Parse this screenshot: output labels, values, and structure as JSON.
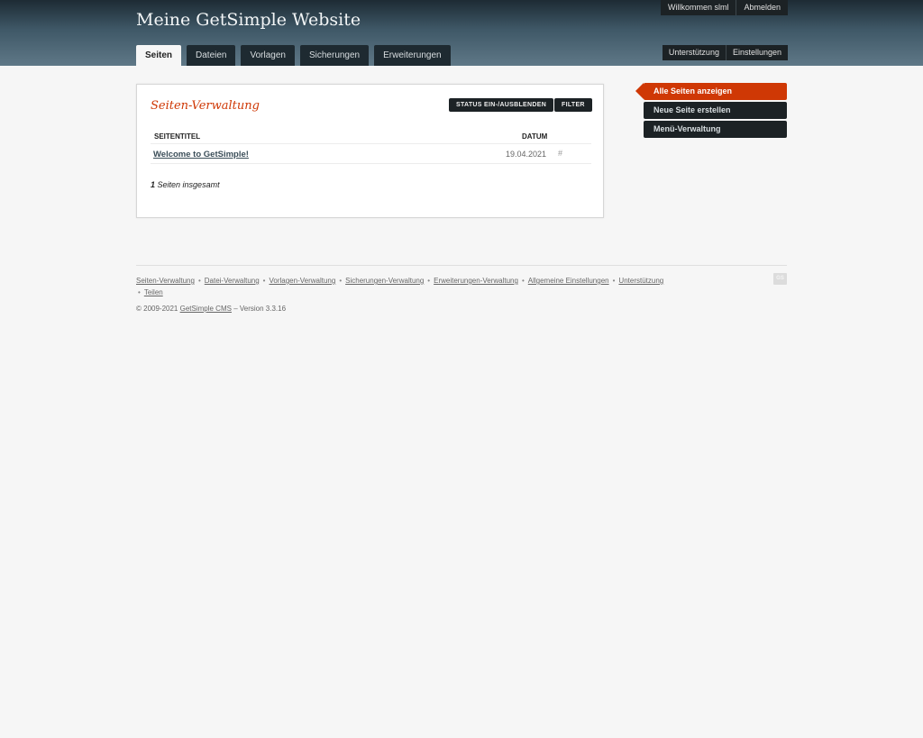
{
  "header": {
    "site_title": "Meine GetSimple Website",
    "welcome": "Willkommen slml",
    "logout": "Abmelden",
    "tabs": [
      {
        "label": "Seiten",
        "active": true
      },
      {
        "label": "Dateien",
        "active": false
      },
      {
        "label": "Vorlagen",
        "active": false
      },
      {
        "label": "Sicherungen",
        "active": false
      },
      {
        "label": "Erweiterungen",
        "active": false
      }
    ],
    "right_tabs": [
      {
        "label": "Unterstützung"
      },
      {
        "label": "Einstellungen"
      }
    ]
  },
  "main": {
    "title": "Seiten-Verwaltung",
    "status_button": "STATUS EIN-/AUSBLENDEN",
    "filter_button": "FILTER",
    "columns": {
      "title": "SEITENTITEL",
      "date": "DATUM"
    },
    "rows": [
      {
        "title": "Welcome to GetSimple!",
        "date": "19.04.2021",
        "hash": "#"
      }
    ],
    "total_count": "1",
    "total_label": "Seiten insgesamt"
  },
  "sidebar": {
    "items": [
      {
        "label": "Alle Seiten anzeigen",
        "active": true
      },
      {
        "label": "Neue Seite erstellen",
        "active": false
      },
      {
        "label": "Menü-Verwaltung",
        "active": false
      }
    ]
  },
  "footer": {
    "links": [
      "Seiten-Verwaltung",
      "Datei-Verwaltung",
      "Vorlagen-Verwaltung",
      "Sicherungen-Verwaltung",
      "Erweiterungen-Verwaltung",
      "Allgemeine Einstellungen",
      "Unterstützung",
      "Teilen"
    ],
    "separator": "•",
    "copyright_prefix": "© 2009-2021",
    "cms_link": "GetSimple CMS",
    "version": "– Version 3.3.16",
    "logo_text": "GS"
  },
  "colors": {
    "accent": "#cf3805",
    "dark_button": "#1c2225"
  }
}
